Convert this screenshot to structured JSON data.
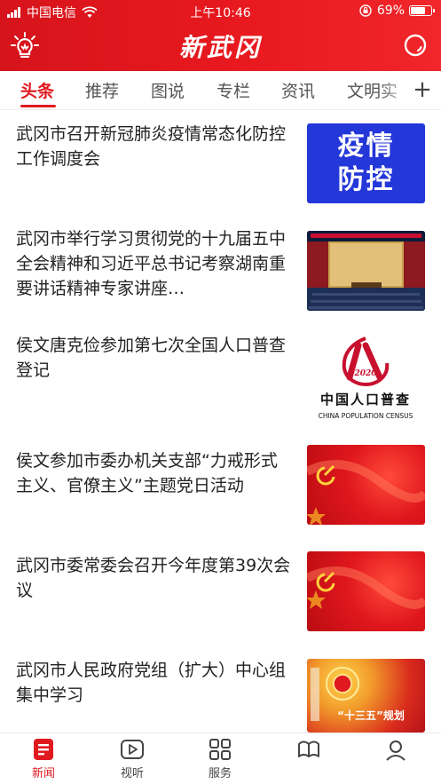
{
  "status_bar": {
    "carrier": "中国电信",
    "time": "上午10:46",
    "battery": "69%"
  },
  "header": {
    "app_title": "新武冈",
    "logo_icon": "lightbulb-logo-icon",
    "search_icon": "search-icon",
    "bg_color": "#e0191f"
  },
  "tabs": {
    "items": [
      "头条",
      "推荐",
      "图说",
      "专栏",
      "资讯",
      "文明实"
    ],
    "active_index": 0,
    "add_label": "+"
  },
  "feed": {
    "items": [
      {
        "title": "武冈市召开新冠肺炎疫情常态化防控工作调度会",
        "thumb_text": [
          "疫情",
          "防控"
        ]
      },
      {
        "title": "武冈市举行学习贯彻党的十九届五中全会精神和习近平总书记考察湖南重要讲话精神专家讲座…"
      },
      {
        "title": "侯文唐克俭参加第七次全国人口普查登记",
        "thumb_text": [
          "2020",
          "中国人口普查",
          "CHINA POPULATION CENSUS"
        ]
      },
      {
        "title": "侯文参加市委办机关支部“力戒形式主义、官僚主义”主题党日活动"
      },
      {
        "title": "武冈市委常委会召开今年度第39次会议"
      },
      {
        "title": "武冈市人民政府党组（扩大）中心组集中学习",
        "thumb_text": [
          "“十三五”规划"
        ]
      }
    ]
  },
  "bottom_nav": {
    "items": [
      {
        "label": "新闻",
        "icon": "news-icon"
      },
      {
        "label": "视听",
        "icon": "play-icon"
      },
      {
        "label": "服务",
        "icon": "grid-icon"
      },
      {
        "label": "",
        "icon": "book-icon"
      },
      {
        "label": "",
        "icon": "profile-icon"
      }
    ],
    "active_index": 0,
    "accent": "#e0191f"
  }
}
